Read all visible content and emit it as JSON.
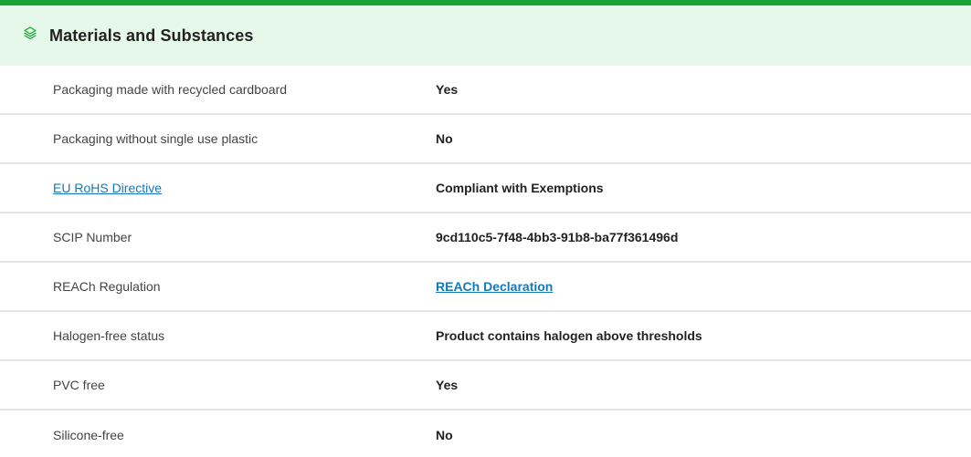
{
  "header": {
    "title": "Materials and Substances",
    "icon": "layers-icon",
    "accent_color": "#17a335",
    "background_color": "#e6f8e9"
  },
  "rows": [
    {
      "label": "Packaging made with recycled cardboard",
      "value": "Yes",
      "label_is_link": false,
      "value_is_link": false
    },
    {
      "label": "Packaging without single use plastic",
      "value": "No",
      "label_is_link": false,
      "value_is_link": false
    },
    {
      "label": "EU RoHS Directive",
      "value": "Compliant with Exemptions",
      "label_is_link": true,
      "value_is_link": false
    },
    {
      "label": "SCIP Number",
      "value": "9cd110c5-7f48-4bb3-91b8-ba77f361496d",
      "label_is_link": false,
      "value_is_link": false
    },
    {
      "label": "REACh Regulation",
      "value": "REACh Declaration",
      "label_is_link": false,
      "value_is_link": true
    },
    {
      "label": "Halogen-free status",
      "value": "Product contains halogen above thresholds",
      "label_is_link": false,
      "value_is_link": false
    },
    {
      "label": "PVC free",
      "value": "Yes",
      "label_is_link": false,
      "value_is_link": false
    },
    {
      "label": "Silicone-free",
      "value": "No",
      "label_is_link": false,
      "value_is_link": false
    }
  ],
  "link_color": "#1479b8"
}
